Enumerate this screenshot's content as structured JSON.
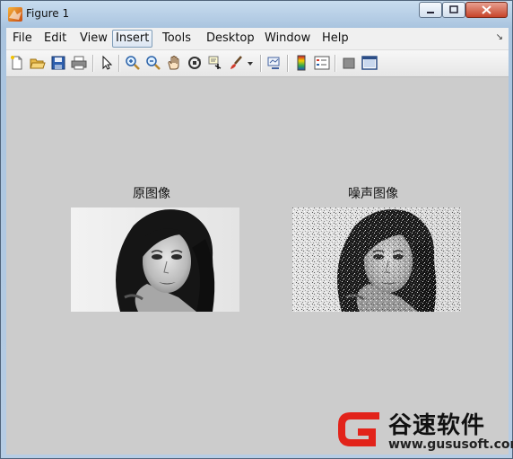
{
  "window": {
    "title": "Figure 1"
  },
  "menu": {
    "items": [
      {
        "label": "File",
        "active": false
      },
      {
        "label": "Edit",
        "active": false
      },
      {
        "label": "View",
        "active": false
      },
      {
        "label": "Insert",
        "active": true
      },
      {
        "label": "Tools",
        "active": false
      },
      {
        "label": "Desktop",
        "active": false
      },
      {
        "label": "Window",
        "active": false
      },
      {
        "label": "Help",
        "active": false
      }
    ]
  },
  "toolbar": {
    "icons": [
      "new-figure-icon",
      "open-file-icon",
      "save-icon",
      "print-icon",
      "pointer-icon",
      "zoom-in-icon",
      "zoom-out-icon",
      "pan-hand-icon",
      "rotate-3d-icon",
      "data-cursor-icon",
      "brush-icon",
      "brush-dropdown-icon",
      "link-plot-icon",
      "colorbar-icon",
      "legend-icon",
      "hide-plot-tools-icon",
      "show-plot-tools-icon"
    ]
  },
  "axes": [
    {
      "title": "原图像"
    },
    {
      "title": "噪声图像"
    }
  ],
  "watermark": {
    "chinese": "谷速软件",
    "url": "www.gususoft.com",
    "brand_color": "#e2231a"
  }
}
